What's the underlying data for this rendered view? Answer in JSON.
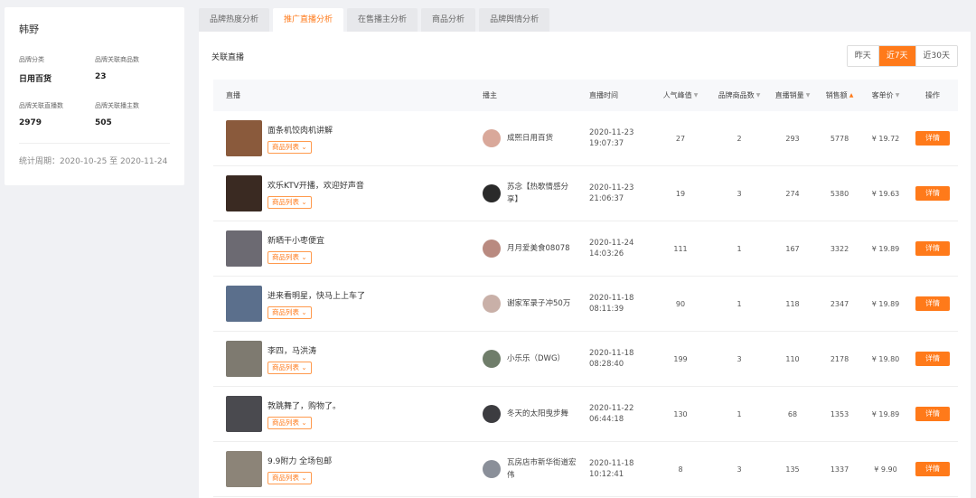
{
  "brand": {
    "name": "韩野",
    "stats": [
      {
        "label": "品牌分类",
        "value": "日用百货"
      },
      {
        "label": "品牌关联商品数",
        "value": "23"
      },
      {
        "label": "品牌关联直播数",
        "value": "2979"
      },
      {
        "label": "品牌关联播主数",
        "value": "505"
      }
    ],
    "period": "统计周期：2020-10-25 至 2020-11-24"
  },
  "tabs": [
    {
      "label": "品牌热度分析",
      "active": false
    },
    {
      "label": "推广直播分析",
      "active": true
    },
    {
      "label": "在售播主分析",
      "active": false
    },
    {
      "label": "商品分析",
      "active": false
    },
    {
      "label": "品牌舆情分析",
      "active": false
    }
  ],
  "section_title": "关联直播",
  "range": [
    {
      "label": "昨天",
      "active": false
    },
    {
      "label": "近7天",
      "active": true
    },
    {
      "label": "近30天",
      "active": false
    }
  ],
  "columns": {
    "live": "直播",
    "host": "播主",
    "time": "直播时间",
    "pop": "人气峰值",
    "prod": "品牌商品数",
    "sales": "直播销量",
    "amt": "销售额",
    "price": "客单价",
    "op": "操作"
  },
  "product_list_label": "商品列表 ⌄",
  "detail_label": "详情",
  "rows": [
    {
      "title": "面条机饺肉机讲解",
      "host": "成熙日用百货",
      "date": "2020-11-23",
      "clock": "19:07:37",
      "pop": "27",
      "prod": "2",
      "sales": "293",
      "amt": "5778",
      "price": "¥ 19.72",
      "thumb_color": "#8a5a3c",
      "avatar_color": "#d9a89a"
    },
    {
      "title": "欢乐KTV开播，欢迎好声音",
      "host": "苏念【热歌情感分享】",
      "date": "2020-11-23",
      "clock": "21:06:37",
      "pop": "19",
      "prod": "3",
      "sales": "274",
      "amt": "5380",
      "price": "¥ 19.63",
      "thumb_color": "#3a2a22",
      "avatar_color": "#2a2a2a"
    },
    {
      "title": "新晒干小枣便宜",
      "host": "月月爱美食08078",
      "date": "2020-11-24",
      "clock": "14:03:26",
      "pop": "111",
      "prod": "1",
      "sales": "167",
      "amt": "3322",
      "price": "¥ 19.89",
      "thumb_color": "#6c6a72",
      "avatar_color": "#b98a80"
    },
    {
      "title": "进来看明星，快马上上车了",
      "host": "谢家军录子冲50万",
      "date": "2020-11-18",
      "clock": "08:11:39",
      "pop": "90",
      "prod": "1",
      "sales": "118",
      "amt": "2347",
      "price": "¥ 19.89",
      "thumb_color": "#5b6f8c",
      "avatar_color": "#c9b0a8"
    },
    {
      "title": "李四，马洪涛",
      "host": "小乐乐（DWG）",
      "date": "2020-11-18",
      "clock": "08:28:40",
      "pop": "199",
      "prod": "3",
      "sales": "110",
      "amt": "2178",
      "price": "¥ 19.80",
      "thumb_color": "#7e7a70",
      "avatar_color": "#6f7d6a"
    },
    {
      "title": "敦跳舞了，购物了。",
      "host": "冬天的太阳曳步舞",
      "date": "2020-11-22",
      "clock": "06:44:18",
      "pop": "130",
      "prod": "1",
      "sales": "68",
      "amt": "1353",
      "price": "¥ 19.89",
      "thumb_color": "#4a4a4f",
      "avatar_color": "#3c3c40"
    },
    {
      "title": "9.9附力 全场包邮",
      "host": "瓦房店市新华街道宏伟",
      "date": "2020-11-18",
      "clock": "10:12:41",
      "pop": "8",
      "prod": "3",
      "sales": "135",
      "amt": "1337",
      "price": "¥ 9.90",
      "thumb_color": "#8c8478",
      "avatar_color": "#8a8f99"
    }
  ]
}
